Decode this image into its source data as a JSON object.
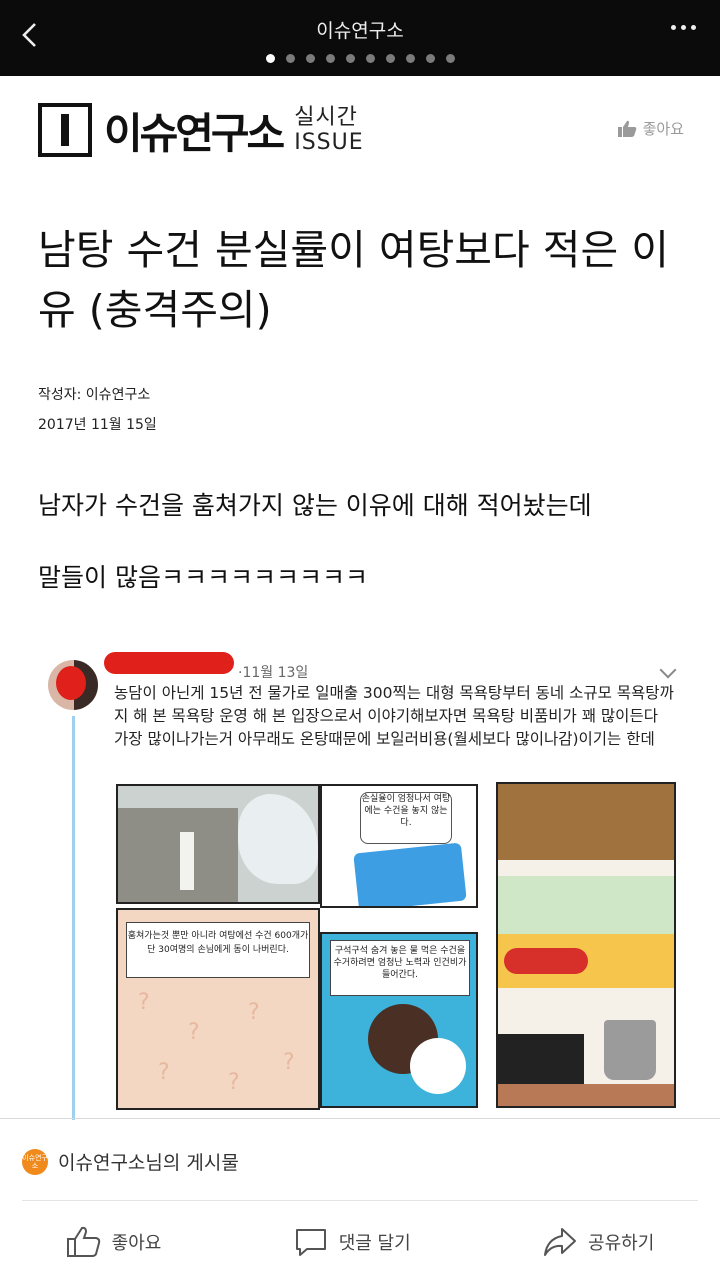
{
  "topbar": {
    "title": "이슈연구소",
    "page_count": 10,
    "active_index": 0,
    "icons": [
      "chevron-left-icon",
      "more-dots-icon"
    ]
  },
  "brand": {
    "name": "이슈연구소",
    "sub_top": "실시간",
    "sub_bottom": "ISSUE",
    "like_label": "좋아요"
  },
  "article": {
    "title": "남탕 수건 분실률이 여탕보다 적은 이유 (충격주의)",
    "author": "작성자: 이슈연구소",
    "date": "2017년 11월 15일",
    "paragraphs": [
      "남자가 수건을 훔쳐가지 않는 이유에 대해 적어놨는데",
      "말들이 많음ㅋㅋㅋㅋㅋㅋㅋㅋㅋ"
    ]
  },
  "tweet": {
    "date": "·11월 13일",
    "text": "농담이 아닌게 15년 전 물가로 일매출 300찍는 대형 목욕탕부터 동네 소규모 목욕탕까지 해 본 목욕탕 운영 해 본 입장으로서 이야기해보자면 목욕탕 비품비가 꽤 많이든다 가장 많이나가는거 아무래도 온탕때문에 보일러비용(월세보다 많이나감)이기는 한데",
    "comic_b": "손실율이 엄청나서 여탕에는 수건을 놓지 않는다.",
    "comic_c": "훔쳐가는것 뿐만 아니라 여탕에선 수건 600개가 단 30여명의 손님에게 동이 나버린다.",
    "comic_d": "구석구석 숨겨 놓은 물 먹은 수건을 수거하려면 엄청난 노력과 인건비가 들어간다."
  },
  "footer": {
    "page_icon_text": "이슈연구소",
    "page_label": "이슈연구소님의 게시물",
    "like": "좋아요",
    "comment": "댓글 달기",
    "share": "공유하기"
  },
  "colors": {
    "topbar_bg": "#0b0b0b",
    "page_icon": "#f08a1c",
    "redaction": "#e0201b",
    "thread_line": "#9ed0f0"
  }
}
